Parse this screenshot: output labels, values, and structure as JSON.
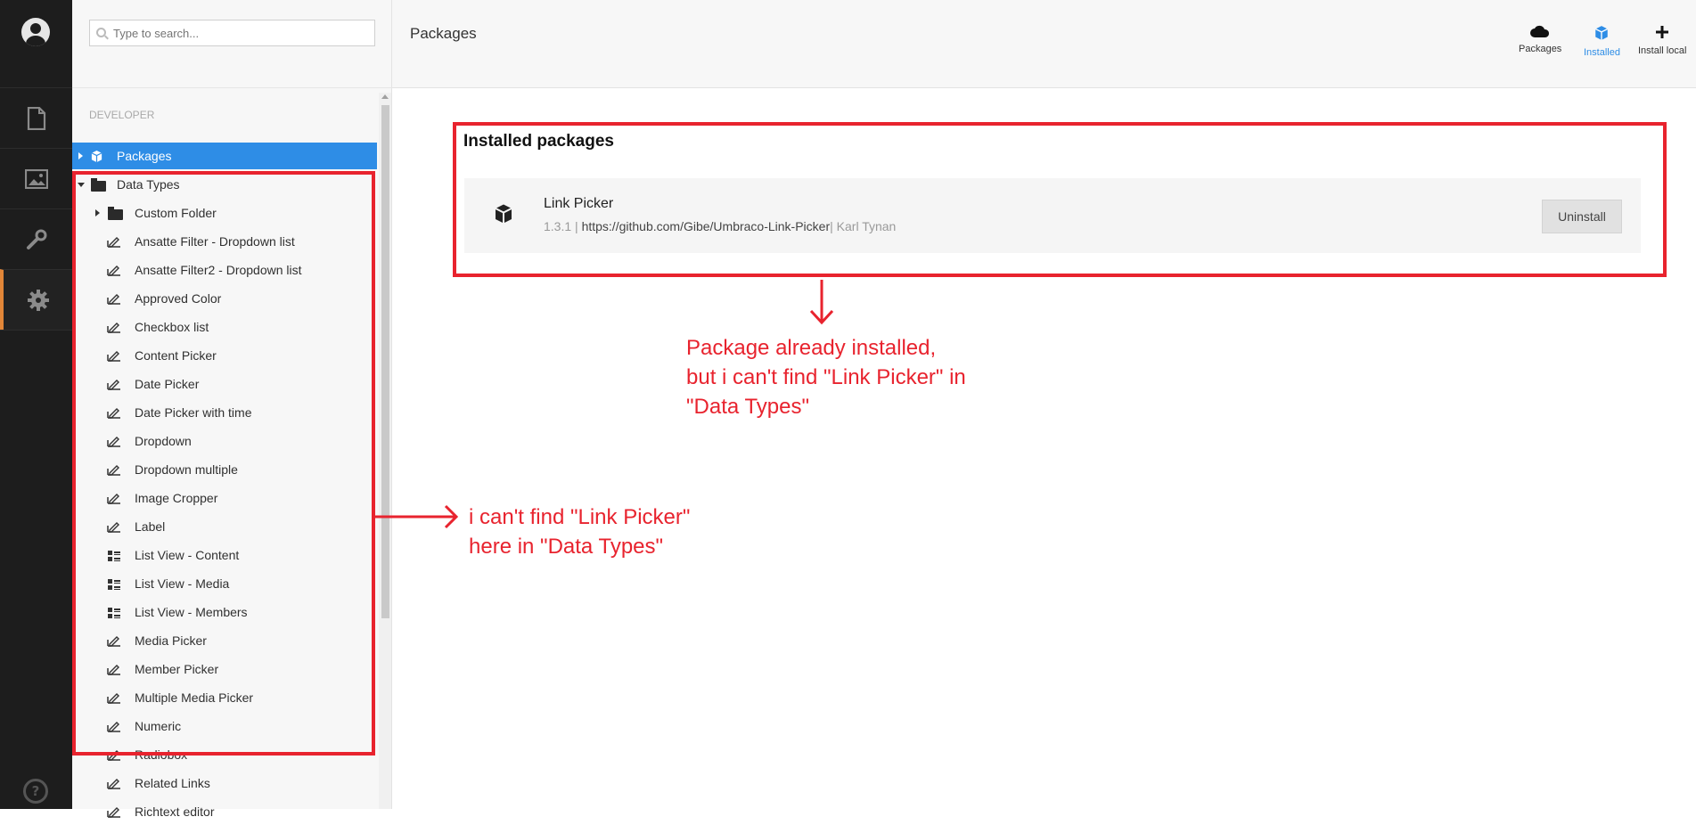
{
  "search": {
    "placeholder": "Type to search..."
  },
  "tree": {
    "section_title": "DEVELOPER",
    "packages_label": "Packages",
    "data_types_label": "Data Types",
    "items": [
      {
        "label": "Custom Folder",
        "icon": "folder-icon"
      },
      {
        "label": "Ansatte Filter - Dropdown list",
        "icon": "edit-icon"
      },
      {
        "label": "Ansatte Filter2 - Dropdown list",
        "icon": "edit-icon"
      },
      {
        "label": "Approved Color",
        "icon": "edit-icon"
      },
      {
        "label": "Checkbox list",
        "icon": "edit-icon"
      },
      {
        "label": "Content Picker",
        "icon": "edit-icon"
      },
      {
        "label": "Date Picker",
        "icon": "edit-icon"
      },
      {
        "label": "Date Picker with time",
        "icon": "edit-icon"
      },
      {
        "label": "Dropdown",
        "icon": "edit-icon"
      },
      {
        "label": "Dropdown multiple",
        "icon": "edit-icon"
      },
      {
        "label": "Image Cropper",
        "icon": "edit-icon"
      },
      {
        "label": "Label",
        "icon": "edit-icon"
      },
      {
        "label": "List View - Content",
        "icon": "list-icon"
      },
      {
        "label": "List View - Media",
        "icon": "list-icon"
      },
      {
        "label": "List View - Members",
        "icon": "list-icon"
      },
      {
        "label": "Media Picker",
        "icon": "edit-icon"
      },
      {
        "label": "Member Picker",
        "icon": "edit-icon"
      },
      {
        "label": "Multiple Media Picker",
        "icon": "edit-icon"
      },
      {
        "label": "Numeric",
        "icon": "edit-icon"
      },
      {
        "label": "Radiobox",
        "icon": "edit-icon"
      },
      {
        "label": "Related Links",
        "icon": "edit-icon"
      },
      {
        "label": "Richtext editor",
        "icon": "edit-icon"
      }
    ]
  },
  "header": {
    "title": "Packages",
    "buttons": [
      {
        "label": "Packages",
        "icon": "cloud-icon"
      },
      {
        "label": "Installed",
        "icon": "cube-icon",
        "active": true
      },
      {
        "label": "Install local",
        "icon": "plus-icon"
      }
    ]
  },
  "installed": {
    "title": "Installed packages",
    "package": {
      "name": "Link Picker",
      "version": "1.3.1",
      "url": "https://github.com/Gibe/Umbraco-Link-Picker",
      "author": "Karl Tynan",
      "uninstall_label": "Uninstall"
    }
  },
  "annotations": {
    "note_1": "Package already installed, but i can't find \"Link Picker\" in \"Data Types\"",
    "note_2": "i can't find \"Link Picker\" here in \"Data Types\""
  },
  "colors": {
    "accent": "#2e8de6",
    "annotation": "#e8232e",
    "rail": "#1d1d1d",
    "active_section": "#e28638"
  }
}
